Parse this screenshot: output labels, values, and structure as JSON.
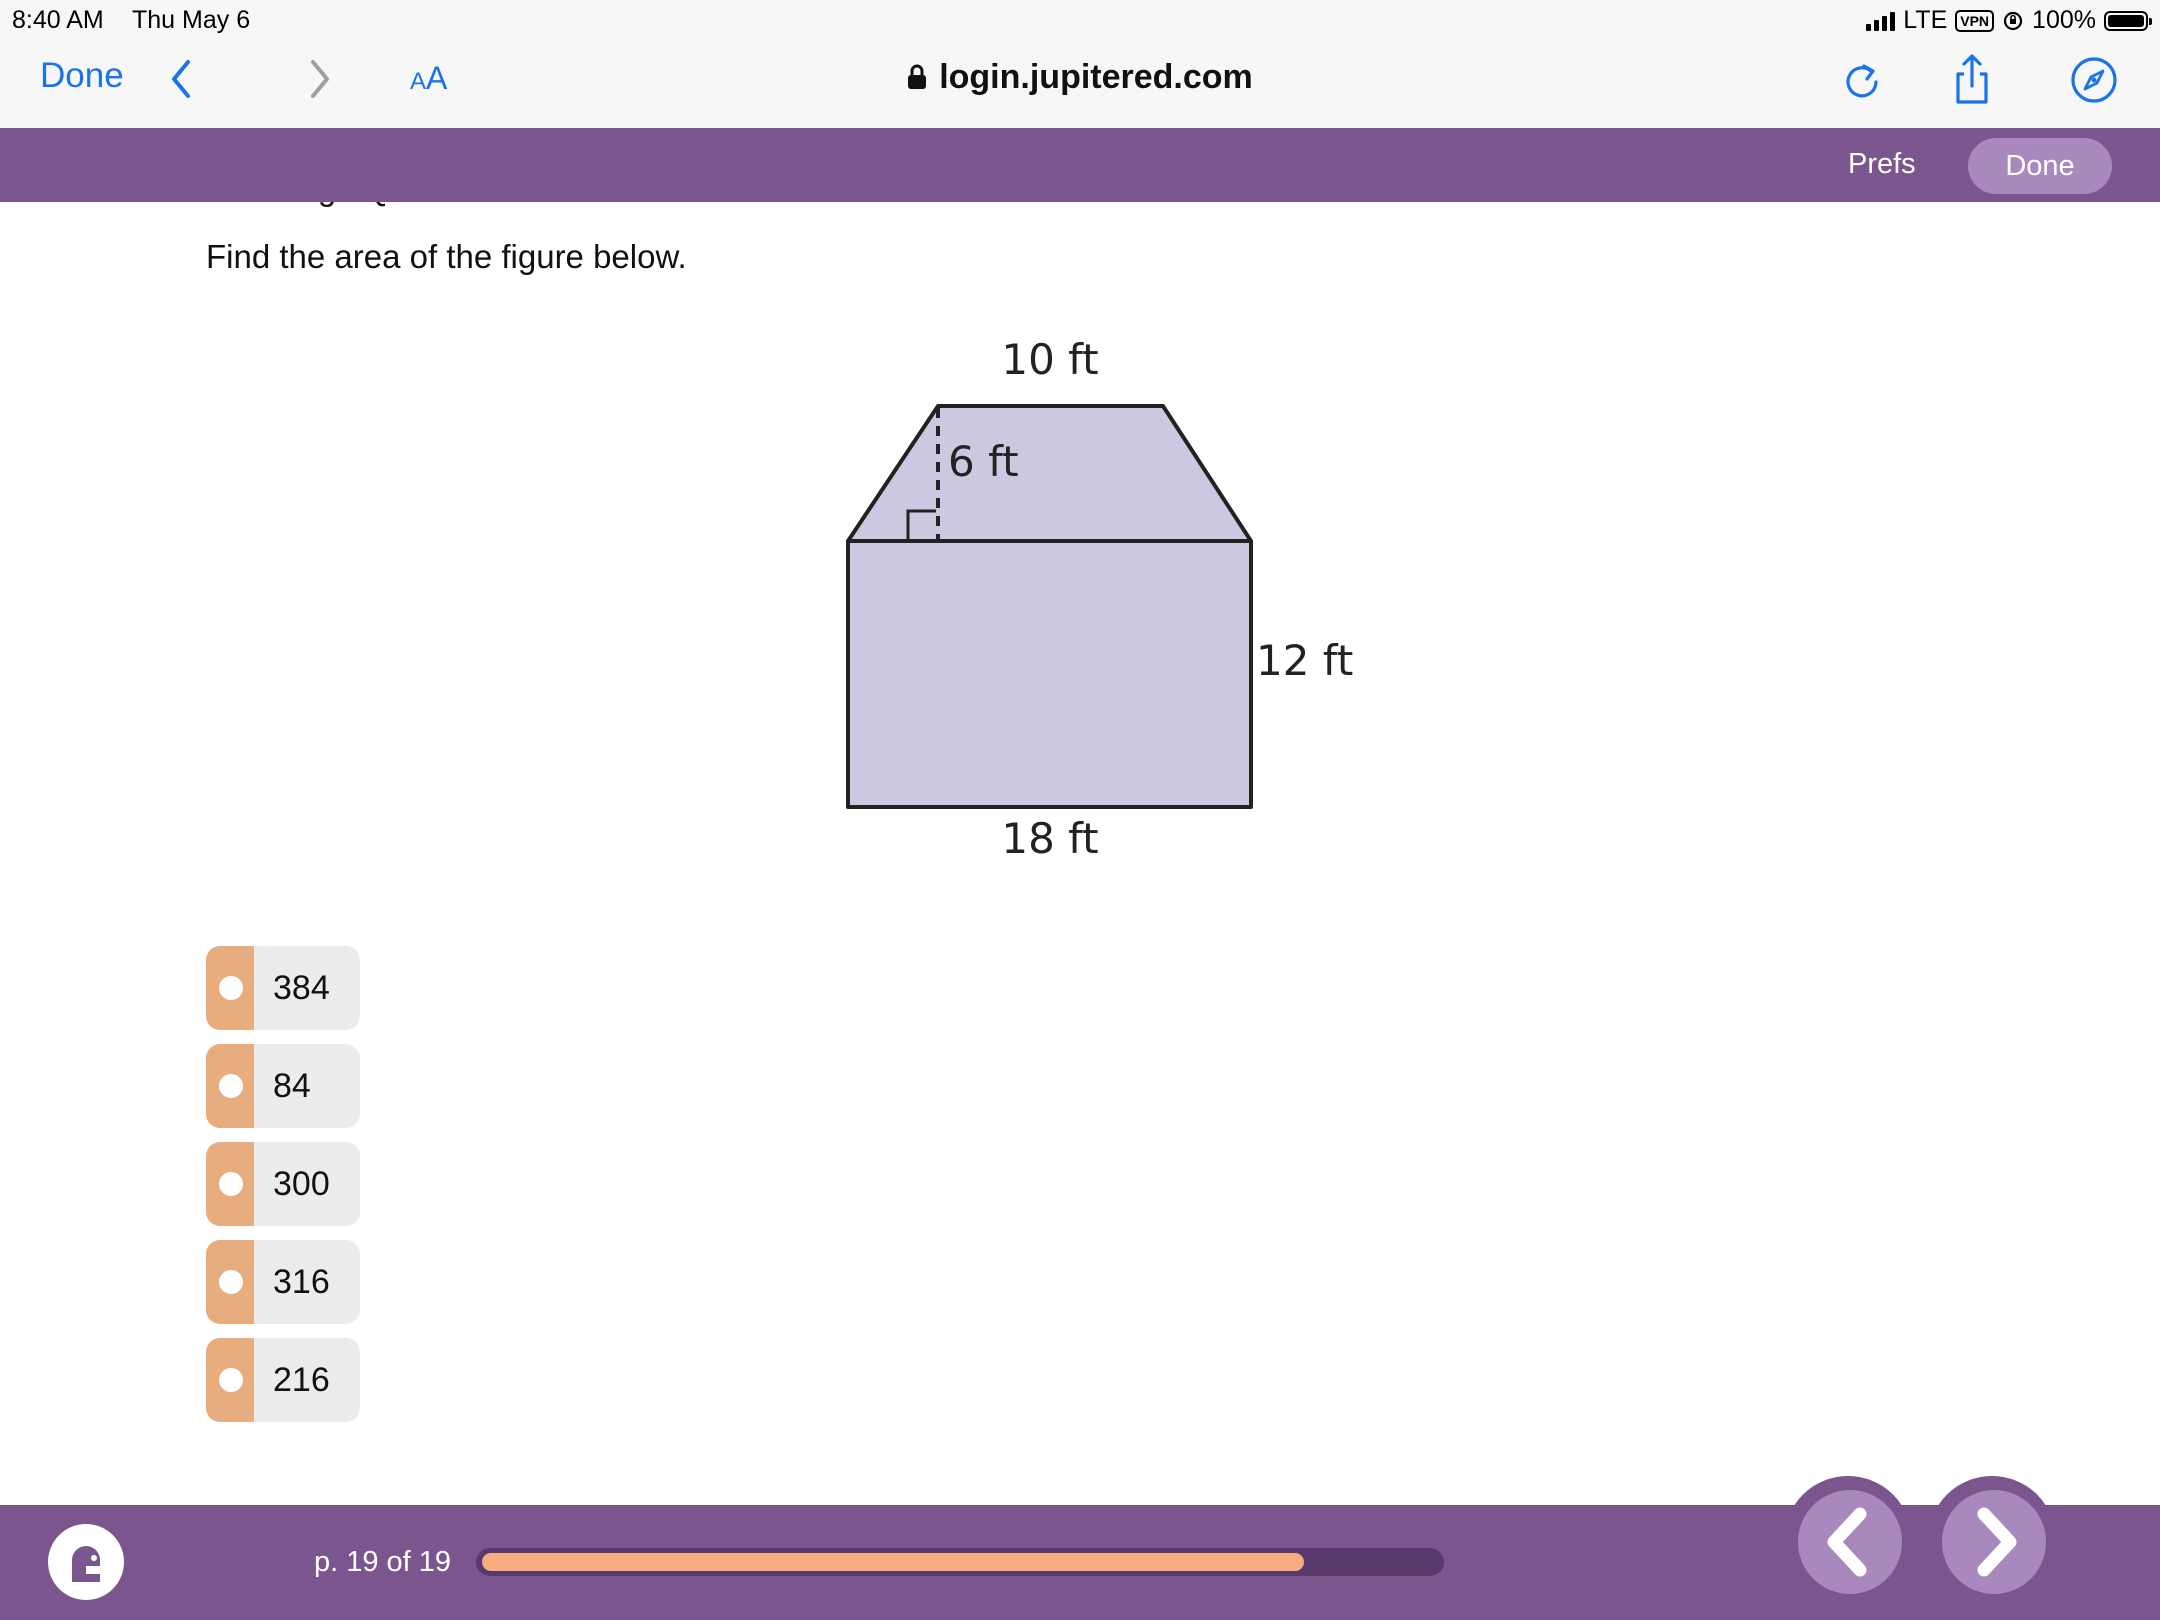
{
  "status_bar": {
    "time": "8:40 AM",
    "date": "Thu May 6",
    "network": "LTE",
    "vpn": "VPN",
    "battery": "100%",
    "battery_level": 1.0
  },
  "browser": {
    "done_label": "Done",
    "text_size_small": "A",
    "text_size_big": "A",
    "url": "login.jupitered.com",
    "icons": [
      "chevron-left-icon",
      "chevron-right-icon",
      "reload-icon",
      "share-icon",
      "compass-icon",
      "lock-icon"
    ],
    "accent_color": "#1a73e8"
  },
  "app_header": {
    "prefs_label": "Prefs",
    "done_label": "Done",
    "bar_color": "#7b568e"
  },
  "content": {
    "section_title": "Challenge Question:",
    "question": "Find the area of the figure below.",
    "figure": {
      "top_label": "10 ft",
      "height_label": "6 ft",
      "side_label": "12 ft",
      "bottom_label": "18 ft",
      "fill_color": "#cdc8e1"
    }
  },
  "answers": [
    {
      "label": "384"
    },
    {
      "label": "84"
    },
    {
      "label": "300"
    },
    {
      "label": "316"
    },
    {
      "label": "216"
    }
  ],
  "footer": {
    "page_text": "p. 19 of 19",
    "progress": 0.86,
    "prev_icon": "chevron-left-icon",
    "next_icon": "chevron-right-icon"
  }
}
